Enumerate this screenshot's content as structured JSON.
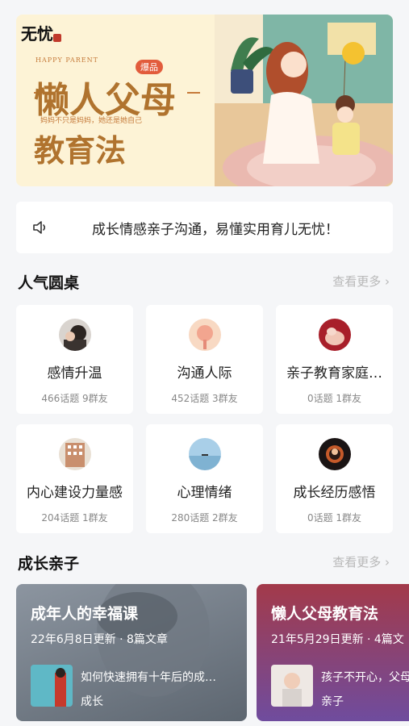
{
  "banner": {
    "brand": "无忧",
    "happy_text": "HAPPY PARENT",
    "title_line1": "懒人父母",
    "badge": "爆品",
    "subtitle": "妈妈不只是妈妈，她还是她自己",
    "title_line2": "教育法"
  },
  "notice": {
    "icon": "speaker-icon",
    "text": "成长情感亲子沟通，易懂实用育儿无忧！"
  },
  "popular": {
    "title": "人气圆桌",
    "more": "查看更多 ›",
    "groups": [
      {
        "name": "感情升温",
        "meta": "466话题 9群友"
      },
      {
        "name": "沟通人际",
        "meta": "452话题 3群友"
      },
      {
        "name": "亲子教育家庭…",
        "meta": "0话题 1群友"
      },
      {
        "name": "内心建设力量感",
        "meta": "204话题 1群友"
      },
      {
        "name": "心理情绪",
        "meta": "280话题 2群友"
      },
      {
        "name": "成长经历感悟",
        "meta": "0话题 1群友"
      }
    ]
  },
  "growth": {
    "title": "成长亲子",
    "more": "查看更多 ›",
    "cards": [
      {
        "title": "成年人的幸福课",
        "info": "22年6月8日更新 · 8篇文章",
        "post_title": "如何快速拥有十年后的成…",
        "post_tag": "成长"
      },
      {
        "title": "懒人父母教育法",
        "info": "21年5月29日更新 · 4篇文",
        "post_title": "孩子不开心，父母",
        "post_tag": "亲子"
      }
    ]
  }
}
